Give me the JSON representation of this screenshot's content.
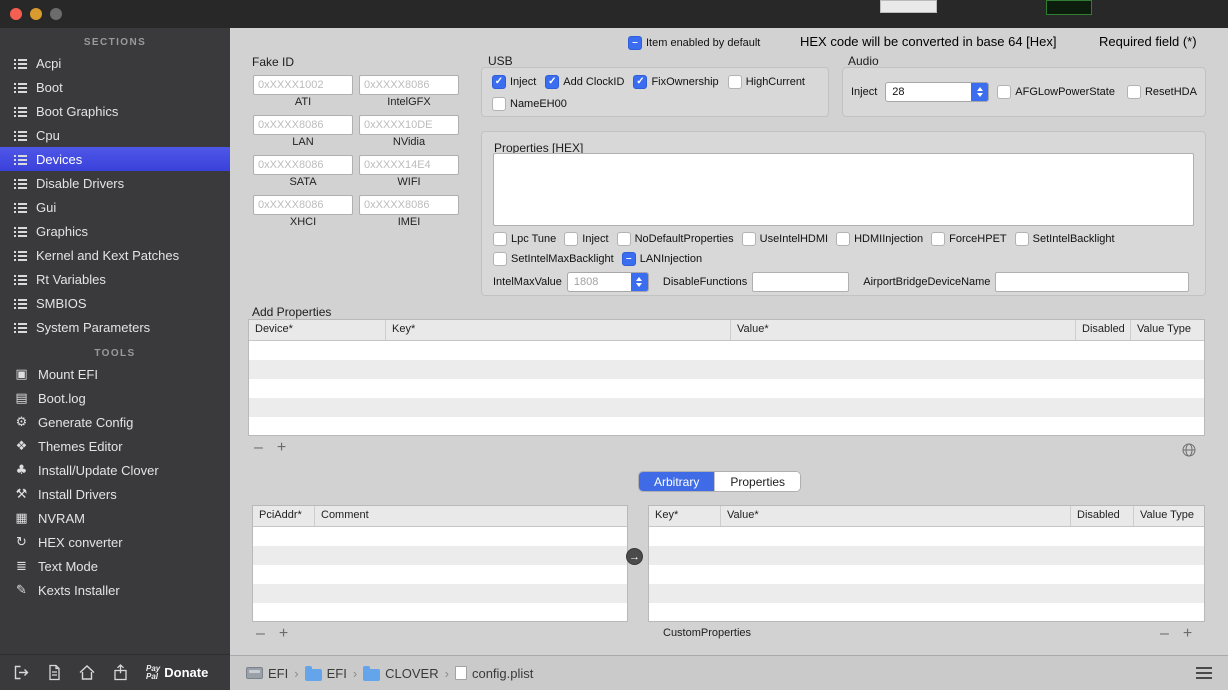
{
  "sidebar": {
    "sections_header": "SECTIONS",
    "sections": [
      {
        "label": "Acpi"
      },
      {
        "label": "Boot"
      },
      {
        "label": "Boot Graphics"
      },
      {
        "label": "Cpu"
      },
      {
        "label": "Devices",
        "selected": true
      },
      {
        "label": "Disable Drivers"
      },
      {
        "label": "Gui"
      },
      {
        "label": "Graphics"
      },
      {
        "label": "Kernel and Kext Patches"
      },
      {
        "label": "Rt Variables"
      },
      {
        "label": "SMBIOS"
      },
      {
        "label": "System Parameters"
      }
    ],
    "tools_header": "TOOLS",
    "tools": [
      {
        "label": "Mount EFI",
        "icon": "mount-efi-icon",
        "glyph": "▣"
      },
      {
        "label": "Boot.log",
        "icon": "boot-log-icon",
        "glyph": "▤"
      },
      {
        "label": "Generate Config",
        "icon": "generate-config-icon",
        "glyph": "⚙"
      },
      {
        "label": "Themes Editor",
        "icon": "themes-editor-icon",
        "glyph": "❖"
      },
      {
        "label": "Install/Update Clover",
        "icon": "clover-icon",
        "glyph": "♣"
      },
      {
        "label": "Install Drivers",
        "icon": "install-drivers-icon",
        "glyph": "⚒"
      },
      {
        "label": "NVRAM",
        "icon": "nvram-chip-icon",
        "glyph": "▦"
      },
      {
        "label": "HEX converter",
        "icon": "hex-converter-icon",
        "glyph": "↻"
      },
      {
        "label": "Text Mode",
        "icon": "text-mode-icon",
        "glyph": "≣"
      },
      {
        "label": "Kexts Installer",
        "icon": "kexts-installer-icon",
        "glyph": "✎"
      }
    ],
    "footer": {
      "donate_label": "Donate",
      "paypal_top": "Pay",
      "paypal_bottom": "Pal"
    }
  },
  "topbar": {
    "item_enabled": [
      {
        "label": "Item enabled by default",
        "state": "mixed"
      }
    ],
    "hex_note": "HEX code will be converted in base 64 [Hex]",
    "required_note": "Required field (*)"
  },
  "fake_id": {
    "title": "Fake ID",
    "fields": [
      {
        "placeholder": "0xXXXX1002",
        "label": "ATI"
      },
      {
        "placeholder": "0xXXXX8086",
        "label": "IntelGFX"
      },
      {
        "placeholder": "0xXXXX8086",
        "label": "LAN"
      },
      {
        "placeholder": "0xXXXX10DE",
        "label": "NVidia"
      },
      {
        "placeholder": "0xXXXX8086",
        "label": "SATA"
      },
      {
        "placeholder": "0xXXXX14E4",
        "label": "WIFI"
      },
      {
        "placeholder": "0xXXXX8086",
        "label": "XHCI"
      },
      {
        "placeholder": "0xXXXX8086",
        "label": "IMEI"
      }
    ]
  },
  "usb": {
    "title": "USB",
    "row1": [
      {
        "label": "Inject",
        "state": "checked"
      },
      {
        "label": "Add ClockID",
        "state": "checked"
      },
      {
        "label": "FixOwnership",
        "state": "checked"
      },
      {
        "label": "HighCurrent",
        "state": "off"
      }
    ],
    "row2": [
      {
        "label": "NameEH00",
        "state": "off"
      }
    ]
  },
  "audio": {
    "title": "Audio",
    "inject_label": "Inject",
    "inject_value": "28",
    "checkboxes": [
      {
        "label": "AFGLowPowerState",
        "state": "off"
      },
      {
        "label": "ResetHDA",
        "state": "off"
      }
    ]
  },
  "properties_hex": {
    "title": "Properties [HEX]",
    "textarea_value": "",
    "row1": [
      {
        "label": "Lpc Tune",
        "state": "off"
      },
      {
        "label": "Inject",
        "state": "off"
      },
      {
        "label": "NoDefaultProperties",
        "state": "off"
      },
      {
        "label": "UseIntelHDMI",
        "state": "off"
      },
      {
        "label": "HDMIInjection",
        "state": "off"
      },
      {
        "label": "ForceHPET",
        "state": "off"
      },
      {
        "label": "SetIntelBacklight",
        "state": "off"
      }
    ],
    "row2": [
      {
        "label": "SetIntelMaxBacklight",
        "state": "off"
      },
      {
        "label": "LANInjection",
        "state": "mixed"
      }
    ],
    "fields_row": {
      "intel_max_value_label": "IntelMaxValue",
      "intel_max_value": "1808",
      "disable_functions_label": "DisableFunctions",
      "disable_functions_value": "",
      "airport_label": "AirportBridgeDeviceName",
      "airport_value": ""
    }
  },
  "add_properties": {
    "title": "Add Properties",
    "columns": [
      "Device*",
      "Key*",
      "Value*",
      "Disabled",
      "Value Type"
    ]
  },
  "tabs": [
    {
      "label": "Arbitrary",
      "selected": true
    },
    {
      "label": "Properties",
      "selected": false
    }
  ],
  "pci_table": {
    "columns": [
      "PciAddr*",
      "Comment"
    ]
  },
  "custom_table": {
    "columns": [
      "Key*",
      "Value*",
      "Disabled",
      "Value Type"
    ],
    "caption": "CustomProperties"
  },
  "statusbar": {
    "separator": "›",
    "path": [
      {
        "label": "EFI",
        "icon": "disk-icon"
      },
      {
        "label": "EFI",
        "icon": "folder-icon"
      },
      {
        "label": "CLOVER",
        "icon": "folder-icon"
      },
      {
        "label": "config.plist",
        "icon": "file-icon"
      }
    ]
  },
  "colors": {
    "accent": "#3a6df0",
    "selection": "#3f47dd"
  }
}
